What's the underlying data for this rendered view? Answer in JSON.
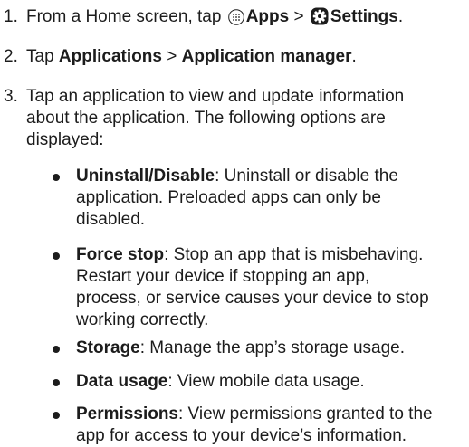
{
  "steps": [
    {
      "num": "1.",
      "prefix": "From a Home screen, tap ",
      "apps_icon": "apps-grid-icon",
      "apps_label": "Apps",
      "separator": " > ",
      "settings_icon": "gear-icon",
      "settings_label": "Settings",
      "suffix": "."
    },
    {
      "num": "2.",
      "prefix": "Tap ",
      "applications_label": "Applications",
      "separator": " > ",
      "manager_label": "Application manager",
      "suffix": "."
    },
    {
      "num": "3.",
      "line1": "Tap an application to view and update information",
      "line2": "about the application. The following options are",
      "line3": "displayed:"
    }
  ],
  "options": [
    {
      "term": "Uninstall/Disable",
      "lines": [
        ": Uninstall or disable the",
        "application. Preloaded apps can only be",
        "disabled."
      ]
    },
    {
      "term": "Force stop",
      "lines": [
        ": Stop an app that is misbehaving.",
        "Restart your device if stopping an app,",
        "process, or service causes your device to stop",
        "working correctly."
      ]
    },
    {
      "term": "Storage",
      "lines": [
        ": Manage the app’s storage usage."
      ]
    },
    {
      "term": "Data usage",
      "lines": [
        ": View mobile data usage."
      ]
    },
    {
      "term": "Permissions",
      "lines": [
        ": View permissions granted to the",
        "app for access to your device’s information."
      ]
    }
  ]
}
